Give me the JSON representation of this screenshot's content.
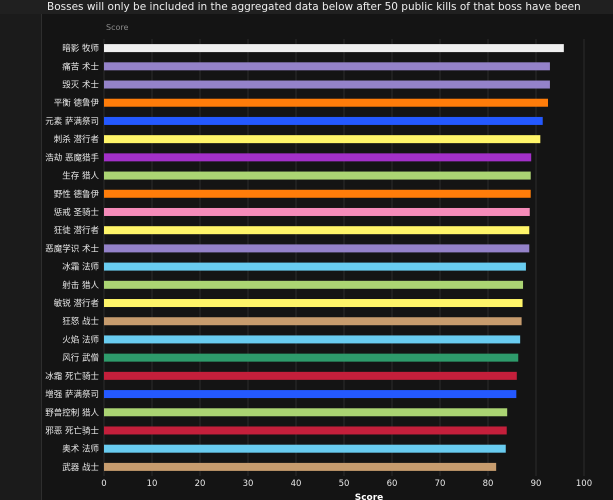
{
  "notice": "Bosses will only be included in the aggregated data below after 50 public kills of that boss have been logged.",
  "chart_data": {
    "type": "bar",
    "orientation": "horizontal",
    "title": "",
    "xlabel": "Score",
    "top_label": "Score",
    "xlim": [
      0,
      100
    ],
    "xticks": [
      0,
      10,
      20,
      30,
      40,
      50,
      60,
      70,
      80,
      90,
      100
    ],
    "grid": true,
    "categories": [
      "暗影 牧师",
      "痛苦 术士",
      "毁灭 术士",
      "平衡 德鲁伊",
      "元素 萨满祭司",
      "刺杀 潜行者",
      "浩劫 恶魔猎手",
      "生存 猎人",
      "野性 德鲁伊",
      "惩戒 圣骑士",
      "狂徒 潜行者",
      "恶魔学识 术士",
      "冰霜 法师",
      "射击 猎人",
      "敏锐 潜行者",
      "狂怒 战士",
      "火焰 法师",
      "风行 武僧",
      "冰霜 死亡骑士",
      "增强 萨满祭司",
      "野兽控制 猎人",
      "邪恶 死亡骑士",
      "奥术 法师",
      "武器 战士"
    ],
    "values": [
      95.8,
      92.9,
      92.9,
      92.5,
      91.4,
      90.9,
      89.0,
      88.9,
      88.9,
      88.7,
      88.6,
      88.6,
      87.9,
      87.3,
      87.2,
      87.0,
      86.7,
      86.3,
      86.0,
      85.9,
      84.0,
      83.9,
      83.7,
      81.7
    ],
    "colors": [
      "#f0f0f0",
      "#9482c9",
      "#9482c9",
      "#ff7d0a",
      "#2459ff",
      "#fff569",
      "#a330c9",
      "#abd473",
      "#ff7d0a",
      "#f58cba",
      "#fff569",
      "#9482c9",
      "#69ccf0",
      "#abd473",
      "#fff569",
      "#c79c6e",
      "#69ccf0",
      "#2e9b6b",
      "#c41f3b",
      "#2459ff",
      "#abd473",
      "#c41f3b",
      "#69ccf0",
      "#c79c6e"
    ]
  },
  "style": {
    "background": "#141414",
    "gridline": "#2c2c2c"
  }
}
